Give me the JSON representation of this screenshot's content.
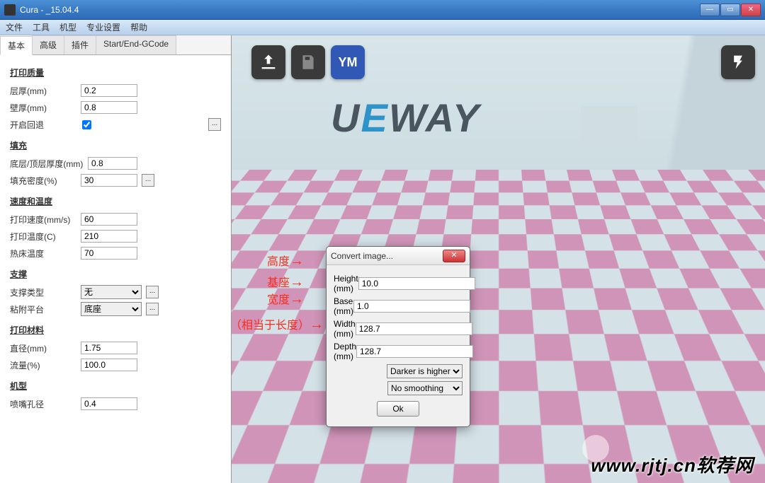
{
  "window": {
    "title": "Cura - _15.04.4",
    "min": "—",
    "max": "▭",
    "close": "✕"
  },
  "menu": [
    "文件",
    "工具",
    "机型",
    "专业设置",
    "帮助"
  ],
  "tabs": [
    "基本",
    "高级",
    "插件",
    "Start/End-GCode"
  ],
  "sections": {
    "print_quality": "打印质量",
    "fill": "填充",
    "speed_temp": "速度和温度",
    "support": "支撑",
    "material": "打印材料",
    "machine": "机型"
  },
  "fields": {
    "layer_height": {
      "label": "层厚(mm)",
      "value": "0.2"
    },
    "wall_thickness": {
      "label": "壁厚(mm)",
      "value": "0.8"
    },
    "retraction": {
      "label": "开启回退"
    },
    "top_bottom": {
      "label": "底层/顶层厚度(mm)",
      "value": "0.8"
    },
    "fill_density": {
      "label": "填充密度(%)",
      "value": "30"
    },
    "print_speed": {
      "label": "打印速度(mm/s)",
      "value": "60"
    },
    "print_temp": {
      "label": "打印温度(C)",
      "value": "210"
    },
    "bed_temp": {
      "label": "热床温度",
      "value": "70"
    },
    "support_type": {
      "label": "支撑类型",
      "value": "无"
    },
    "adhesion": {
      "label": "粘附平台",
      "value": "底座"
    },
    "diameter": {
      "label": "直径(mm)",
      "value": "1.75"
    },
    "flow": {
      "label": "流量(%)",
      "value": "100.0"
    },
    "nozzle": {
      "label": "喷嘴孔径",
      "value": "0.4"
    }
  },
  "scene": {
    "logo_text": "UEWAY",
    "ym": "YM"
  },
  "annotations": {
    "height": "高度",
    "base": "基座",
    "width": "宽度",
    "depth": "深度（相当于长度）"
  },
  "dialog": {
    "title": "Convert image...",
    "height": {
      "label": "Height (mm)",
      "value": "10.0"
    },
    "base": {
      "label": "Base (mm)",
      "value": "1.0"
    },
    "width": {
      "label": "Width (mm)",
      "value": "128.7"
    },
    "depth": {
      "label": "Depth (mm)",
      "value": "128.7"
    },
    "mode": "Darker is higher",
    "smooth": "No smoothing",
    "ok": "Ok",
    "close": "✕"
  },
  "watermark": "www.rjtj.cn软荐网",
  "dots": "..."
}
